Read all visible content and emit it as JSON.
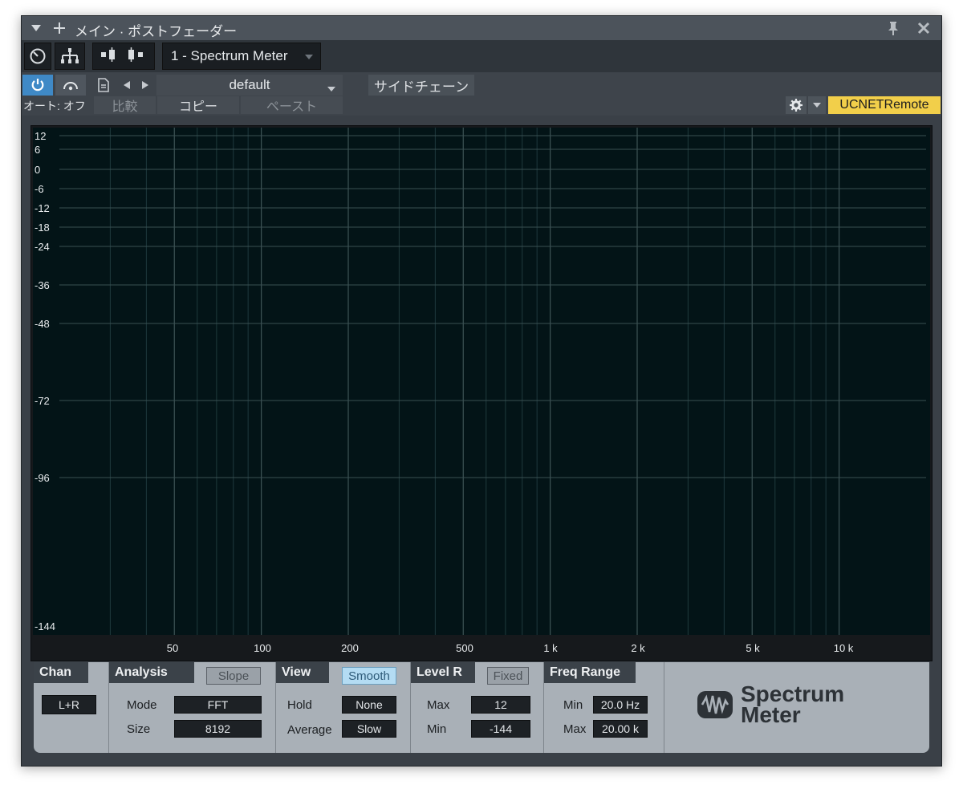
{
  "window": {
    "title": "メイン · ポストフェーダー"
  },
  "toolbar": {
    "plugin_name": "1 - Spectrum Meter",
    "preset_name": "default",
    "sidechain_label": "サイドチェーン",
    "auto_label": "オート: オフ",
    "compare_label": "比較",
    "copy_label": "コピー",
    "paste_label": "ペースト",
    "remote_label": "UCNETRemote"
  },
  "graph": {
    "y_labels": [
      "12",
      "6",
      "0",
      "-6",
      "-12",
      "-18",
      "-24",
      "-36",
      "-48",
      "-72",
      "-96",
      "-144"
    ],
    "x_labels": [
      "50",
      "100",
      "200",
      "500",
      "1 k",
      "2 k",
      "5 k",
      "10 k"
    ]
  },
  "controls": {
    "chan": {
      "title": "Chan",
      "value": "L+R"
    },
    "analysis": {
      "title": "Analysis",
      "toggle": "Slope",
      "mode_label": "Mode",
      "mode_value": "FFT",
      "size_label": "Size",
      "size_value": "8192"
    },
    "view": {
      "title": "View",
      "toggle": "Smooth",
      "hold_label": "Hold",
      "hold_value": "None",
      "average_label": "Average",
      "average_value": "Slow"
    },
    "level": {
      "title": "Level R",
      "toggle": "Fixed",
      "max_label": "Max",
      "max_value": "12",
      "min_label": "Min",
      "min_value": "-144"
    },
    "freq": {
      "title": "Freq Range",
      "min_label": "Min",
      "min_value": "20.0 Hz",
      "max_label": "Max",
      "max_value": "20.00 k"
    }
  },
  "logo": {
    "line1": "Spectrum",
    "line2": "Meter"
  },
  "colors": {
    "remote_bg": "#f2cf4a",
    "accent_blue": "#3f89c6",
    "smooth_on": "#b4dcf3",
    "graph_bg": "#031417"
  }
}
